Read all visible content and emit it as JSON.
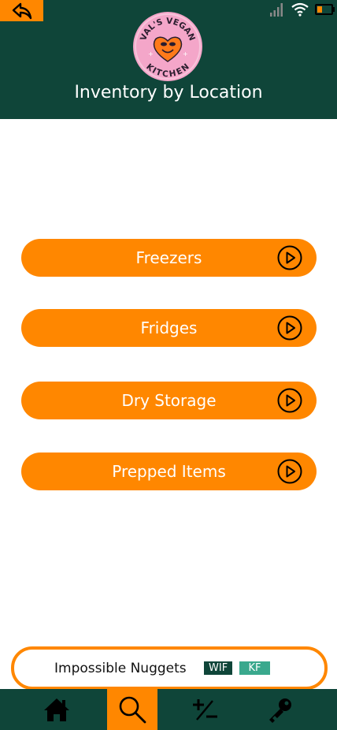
{
  "header": {
    "title": "Inventory by Location",
    "logo_text": "VAL'S VEGAN KITCHEN"
  },
  "locations": [
    {
      "label": "Freezers"
    },
    {
      "label": "Fridges"
    },
    {
      "label": "Dry Storage"
    },
    {
      "label": "Prepped Items"
    }
  ],
  "now_playing": {
    "item": "Impossible Nuggets",
    "badges": [
      "WIF",
      "KF"
    ]
  },
  "nav": {
    "items": [
      {
        "icon": "home-icon"
      },
      {
        "icon": "search-icon",
        "active": true
      },
      {
        "icon": "plus-minus-icon"
      },
      {
        "icon": "key-icon"
      }
    ]
  },
  "colors": {
    "header_bg": "#0f4539",
    "accent": "#ff8700",
    "badge_kf": "#3aa88d"
  }
}
